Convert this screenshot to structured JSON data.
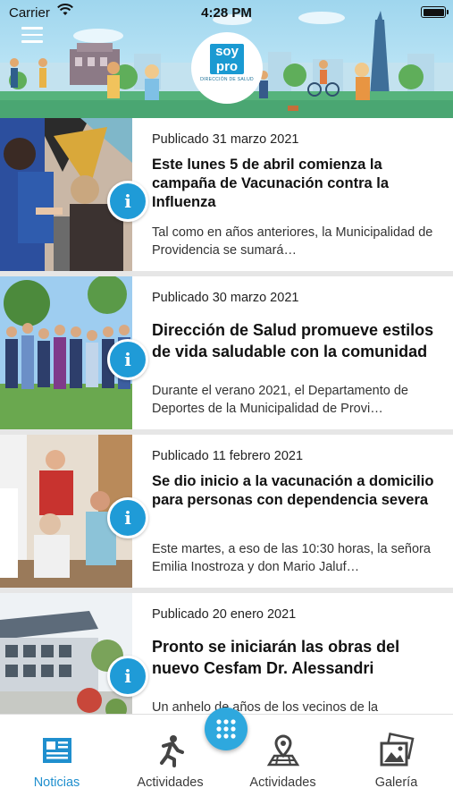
{
  "status_bar": {
    "carrier": "Carrier",
    "time": "4:28 PM"
  },
  "header": {
    "logo": {
      "line1": "soy",
      "line2": "pro",
      "subtitle": "DIRECCIÓN DE SALUD"
    }
  },
  "news": [
    {
      "date": "Publicado 31 marzo 2021",
      "title": "Este lunes 5 de abril comienza la campaña de Vacunación contra la Influenza",
      "excerpt": "Tal como en años anteriores, la Municipalidad de Providencia se sumará…"
    },
    {
      "date": "Publicado 30 marzo 2021",
      "title": "Dirección de Salud promueve estilos de vida saludable con la comunidad",
      "excerpt": "Durante el verano 2021, el Departamento de Deportes de la Municipalidad de Provi…"
    },
    {
      "date": "Publicado 11 febrero 2021",
      "title": "Se dio inicio a la vacunación a domicilio para personas con dependencia severa",
      "excerpt": "Este martes, a eso de las 10:30 horas, la señora Emilia Inostroza y don Mario Jaluf…"
    },
    {
      "date": "Publicado 20 enero 2021",
      "title": "Pronto se iniciarán las obras del nuevo Cesfam Dr. Alessandri",
      "excerpt": "Un anhelo de años de los vecinos de la"
    }
  ],
  "info_badge": "i",
  "tabs": [
    {
      "label": "Noticias",
      "icon": "newspaper-icon",
      "active": true
    },
    {
      "label": "Actividades",
      "icon": "running-person-icon",
      "active": false
    },
    {
      "label": "Actividades",
      "icon": "map-pin-icon",
      "active": false
    },
    {
      "label": "Galería",
      "icon": "photo-gallery-icon",
      "active": false
    }
  ],
  "colors": {
    "accent": "#1f8fce",
    "badge": "#1f9bd7",
    "fab": "#2ea8de",
    "tab_inactive": "#3a3a3a"
  }
}
